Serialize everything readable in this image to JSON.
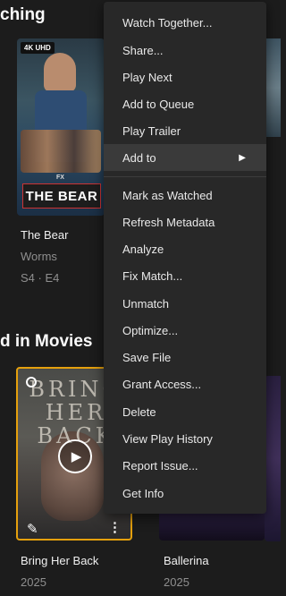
{
  "sections": {
    "continue_watching": "ching",
    "recently_added": "d in Movies"
  },
  "continue_watching": [
    {
      "title": "The Bear",
      "subtitle": "Worms",
      "episode": "S4 · E4",
      "badge": "4K UHD",
      "network": "FX",
      "logo_text": "THE BEAR"
    }
  ],
  "recently_added": [
    {
      "title": "Bring Her Back",
      "year": "2025",
      "poster_text": "BRING HER BACK"
    },
    {
      "title": "Ballerina",
      "year": "2025"
    }
  ],
  "menu": {
    "items": [
      {
        "label": "Watch Together..."
      },
      {
        "label": "Share..."
      },
      {
        "label": "Play Next"
      },
      {
        "label": "Add to Queue"
      },
      {
        "label": "Play Trailer"
      },
      {
        "label": "Add to",
        "submenu_arrow": "▶"
      },
      {
        "label": "Mark as Watched"
      },
      {
        "label": "Refresh Metadata"
      },
      {
        "label": "Analyze"
      },
      {
        "label": "Fix Match..."
      },
      {
        "label": "Unmatch"
      },
      {
        "label": "Optimize..."
      },
      {
        "label": "Save File"
      },
      {
        "label": "Grant Access..."
      },
      {
        "label": "Delete"
      },
      {
        "label": "View Play History"
      },
      {
        "label": "Report Issue..."
      },
      {
        "label": "Get Info"
      }
    ],
    "highlighted_item": "Add to"
  },
  "icons": {
    "play": "play-icon",
    "select": "select-circle-icon",
    "edit": "pencil-icon",
    "more": "more-vertical-icon",
    "submenu": "chevron-right-icon"
  },
  "colors": {
    "background": "#1c1c1c",
    "menu_background": "#282828",
    "menu_highlight": "#3a3a3a",
    "selection_border": "#e5a00d"
  }
}
